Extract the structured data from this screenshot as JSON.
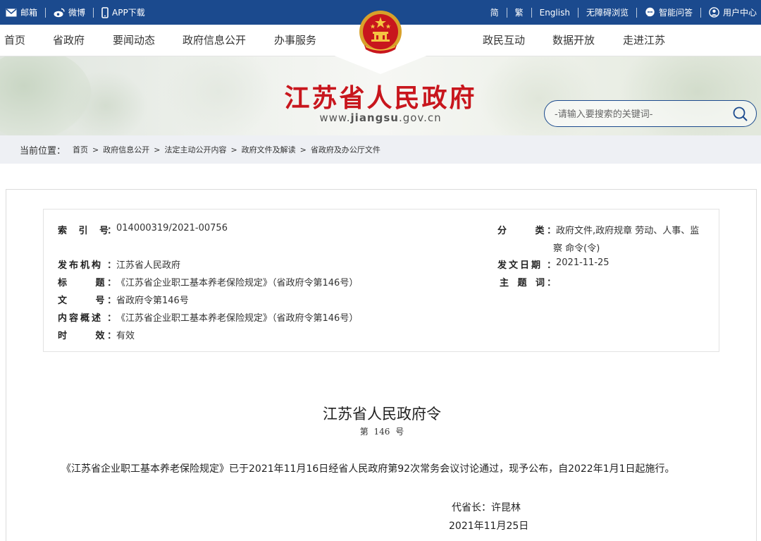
{
  "topbar": {
    "left": [
      {
        "icon": "mail-icon",
        "label": "邮箱"
      },
      {
        "icon": "weibo-icon",
        "label": "微博"
      },
      {
        "icon": "phone-icon",
        "label": "APP下载"
      }
    ],
    "right": [
      {
        "label": "简"
      },
      {
        "label": "繁"
      },
      {
        "label": "English"
      },
      {
        "label": "无障碍浏览"
      },
      {
        "icon": "chat-icon",
        "label": "智能问答"
      },
      {
        "icon": "user-icon",
        "label": "用户中心"
      }
    ]
  },
  "nav": {
    "left": [
      "首页",
      "省政府",
      "要闻动态",
      "政府信息公开",
      "办事服务"
    ],
    "right": [
      "政民互动",
      "数据开放",
      "走进江苏"
    ]
  },
  "site": {
    "title": "江苏省人民政府",
    "domain_prefix": "www.",
    "domain_bold": "jiangsu",
    "domain_suffix": ".gov.cn"
  },
  "search": {
    "placeholder": "-请输入要搜索的关键词-"
  },
  "breadcrumb": {
    "label": "当前位置：",
    "items": [
      "首页",
      "政府信息公开",
      "法定主动公开内容",
      "政府文件及解读",
      "省政府及办公厅文件"
    ],
    "separator": ">"
  },
  "meta": {
    "index_label": "索 引 号",
    "index_value": "014000319/2021-00756",
    "category_label": "分 类",
    "category_value_line1": "政府文件,政府规章 劳动、人事、监",
    "category_value_line2": "察 命令(令)",
    "issuer_label": "发布机构",
    "issuer_value": "江苏省人民政府",
    "date_label": "发文日期",
    "date_value": "2021-11-25",
    "title_label": "标 题",
    "title_value": "《江苏省企业职工基本养老保险规定》（省政府令第146号）",
    "keywords_label": "主 题 词",
    "keywords_value": "",
    "docno_label": "文 号",
    "docno_value": "省政府令第146号",
    "summary_label": "内容概述",
    "summary_value": "《江苏省企业职工基本养老保险规定》（省政府令第146号）",
    "validity_label": "时 效",
    "validity_value": "有效",
    "colon": "："
  },
  "document": {
    "title": "江苏省人民政府令",
    "number": "第 146 号",
    "body": "《江苏省企业职工基本养老保险规定》已于2021年11月16日经省人民政府第92次常务会议讨论通过，现予公布，自2022年1月1日起施行。",
    "signature": "代省长：许昆林",
    "date": "2021年11月25日"
  },
  "colors": {
    "brand_blue": "#1b4a8e",
    "title_red": "#c8161d"
  }
}
